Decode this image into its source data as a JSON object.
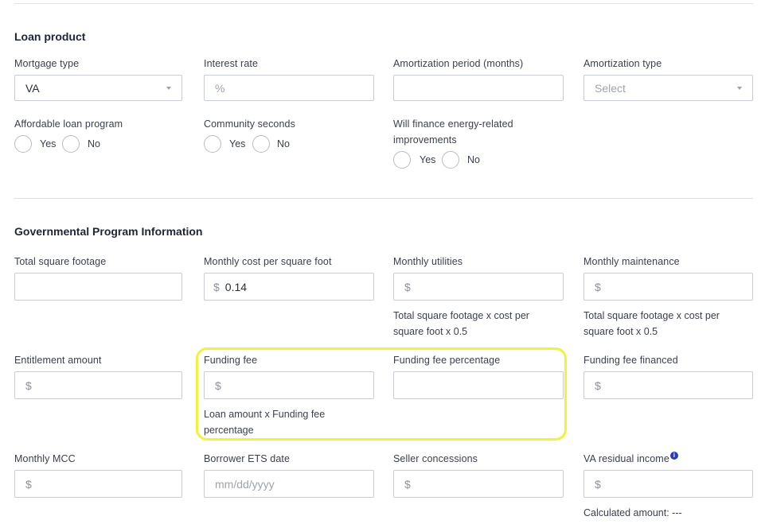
{
  "loan_product": {
    "title": "Loan product",
    "mortgage_type": {
      "label": "Mortgage type",
      "value": "VA"
    },
    "interest_rate": {
      "label": "Interest rate",
      "placeholder": "%"
    },
    "amortization_period": {
      "label": "Amortization period (months)",
      "value": ""
    },
    "amortization_type": {
      "label": "Amortization type",
      "placeholder": "Select"
    },
    "affordable_loan_program": {
      "label": "Affordable loan program",
      "yes": "Yes",
      "no": "No"
    },
    "community_seconds": {
      "label": "Community seconds",
      "yes": "Yes",
      "no": "No"
    },
    "energy_improvements": {
      "label": "Will finance energy-related improvements",
      "yes": "Yes",
      "no": "No"
    }
  },
  "gov_program": {
    "title": "Governmental Program Information",
    "total_square_footage": {
      "label": "Total square footage",
      "value": ""
    },
    "monthly_cost_per_sqft": {
      "label": "Monthly cost per square foot",
      "prefix": "$",
      "value": "0.14"
    },
    "monthly_utilities": {
      "label": "Monthly utilities",
      "prefix": "$",
      "hint": "Total square footage x cost per square foot x 0.5"
    },
    "monthly_maintenance": {
      "label": "Monthly maintenance",
      "prefix": "$",
      "hint": "Total square footage x cost per square foot x 0.5"
    },
    "entitlement_amount": {
      "label": "Entitlement amount",
      "prefix": "$"
    },
    "funding_fee": {
      "label": "Funding fee",
      "prefix": "$",
      "hint": "Loan amount x Funding fee percentage"
    },
    "funding_fee_percentage": {
      "label": "Funding fee percentage",
      "value": ""
    },
    "funding_fee_financed": {
      "label": "Funding fee financed",
      "prefix": "$"
    },
    "monthly_mcc": {
      "label": "Monthly MCC",
      "prefix": "$"
    },
    "borrower_ets_date": {
      "label": "Borrower ETS date",
      "placeholder": "mm/dd/yyyy"
    },
    "seller_concessions": {
      "label": "Seller concessions",
      "prefix": "$"
    },
    "va_residual_income": {
      "label": "VA residual income",
      "info": "i",
      "prefix": "$",
      "hint": "Calculated amount: ---"
    }
  },
  "colors": {
    "highlight": "#f2f23a",
    "info_icon": "#2a3bb8",
    "border": "#c9ccd3"
  }
}
